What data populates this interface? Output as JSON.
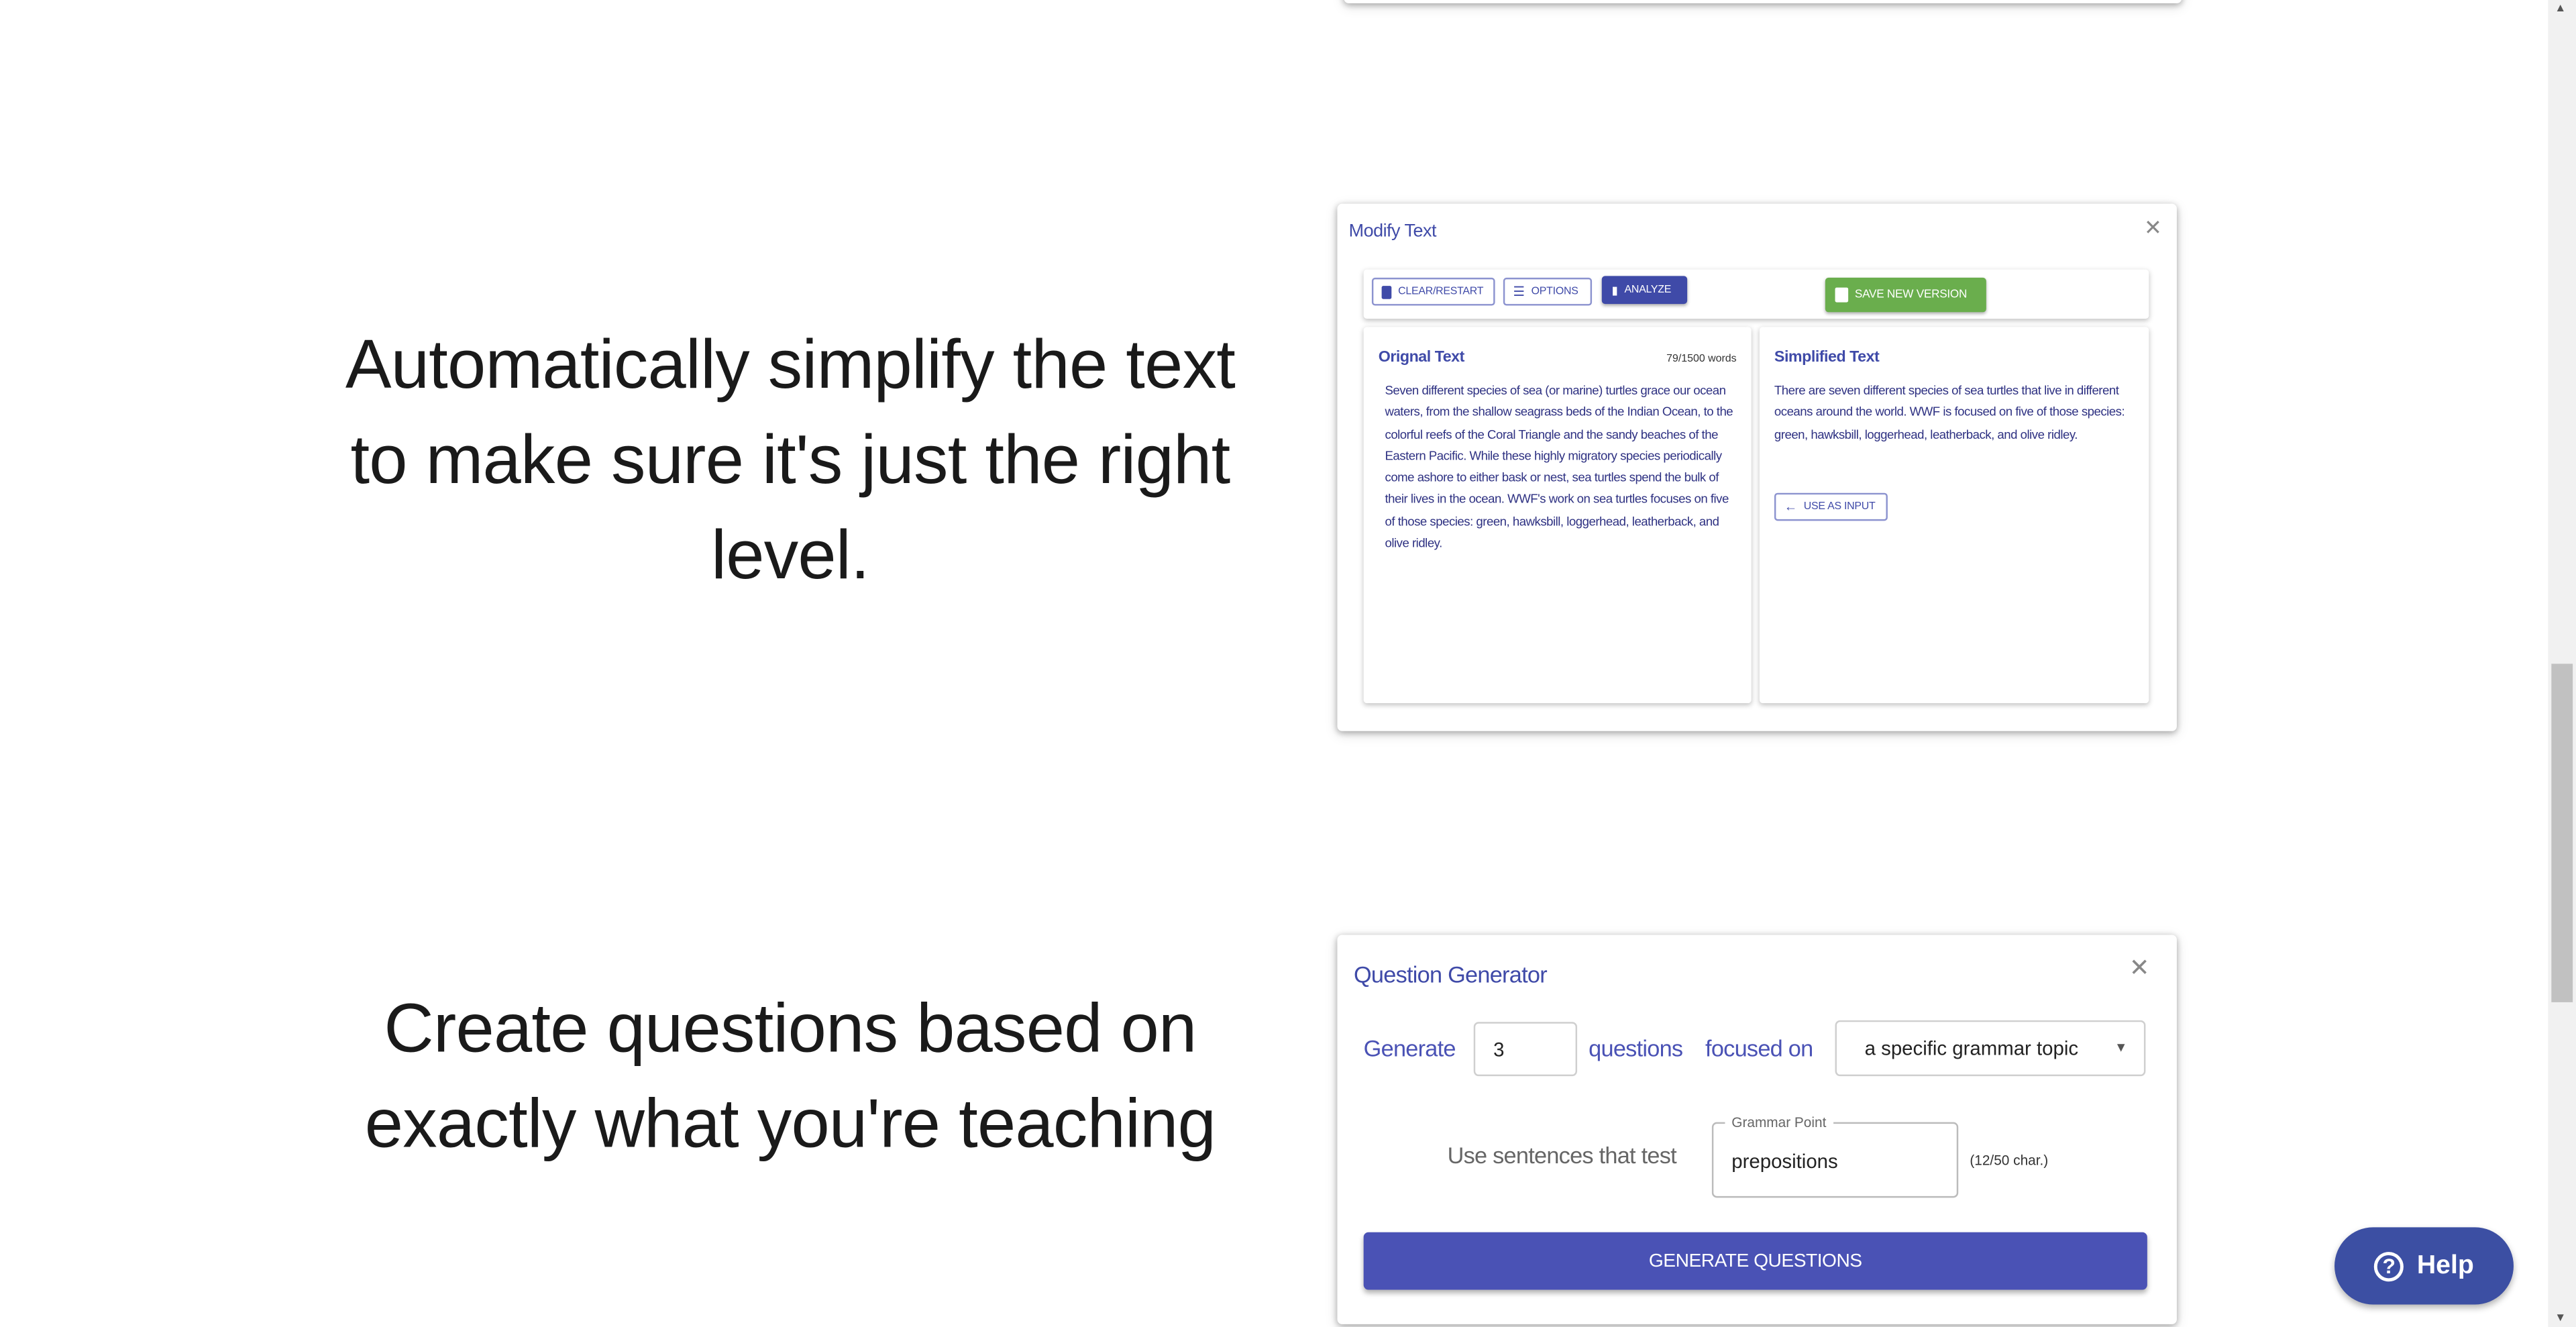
{
  "hero": {
    "simplify": "Automatically simplify the text to make sure it's just the right level.",
    "questions": "Create questions based on exactly what you're teaching"
  },
  "modify_text": {
    "title": "Modify Text",
    "toolbar": {
      "clear_restart": "CLEAR/RESTART",
      "options": "OPTIONS",
      "analyze": "ANALYZE",
      "save_new_version": "SAVE NEW VERSION"
    },
    "original": {
      "heading": "Orignal Text",
      "word_count": "79/1500 words",
      "text": "Seven different species of sea (or marine) turtles grace our ocean waters, from the shallow seagrass beds of the Indian Ocean, to the colorful reefs of the Coral Triangle and the sandy beaches of the Eastern Pacific. While these highly migratory species periodically come ashore to either bask or nest, sea turtles spend the bulk of their lives in the ocean. WWF's work on sea turtles focuses on five of those species: green, hawksbill, loggerhead, leatherback, and olive ridley."
    },
    "simplified": {
      "heading": "Simplified Text",
      "text": "There are seven different species of sea turtles that live in different oceans around the world. WWF is focused on five of those species: green, hawksbill, loggerhead, leatherback, and olive ridley.",
      "use_as_input": "USE AS INPUT"
    }
  },
  "question_generator": {
    "title": "Question Generator",
    "generate_label": "Generate",
    "count_value": "3",
    "questions_label": "questions",
    "focused_on_label": "focused on",
    "focus_select": "a specific grammar topic",
    "use_sentences_label": "Use sentences that test",
    "grammar_point_label": "Grammar Point",
    "grammar_point_value": "prepositions",
    "char_count": "(12/50 char.)",
    "generate_button": "GENERATE QUESTIONS"
  },
  "help": {
    "label": "Help"
  },
  "colors": {
    "indigo": "#3f4aa8",
    "green": "#6aae4d",
    "help": "#3c4fa3"
  }
}
